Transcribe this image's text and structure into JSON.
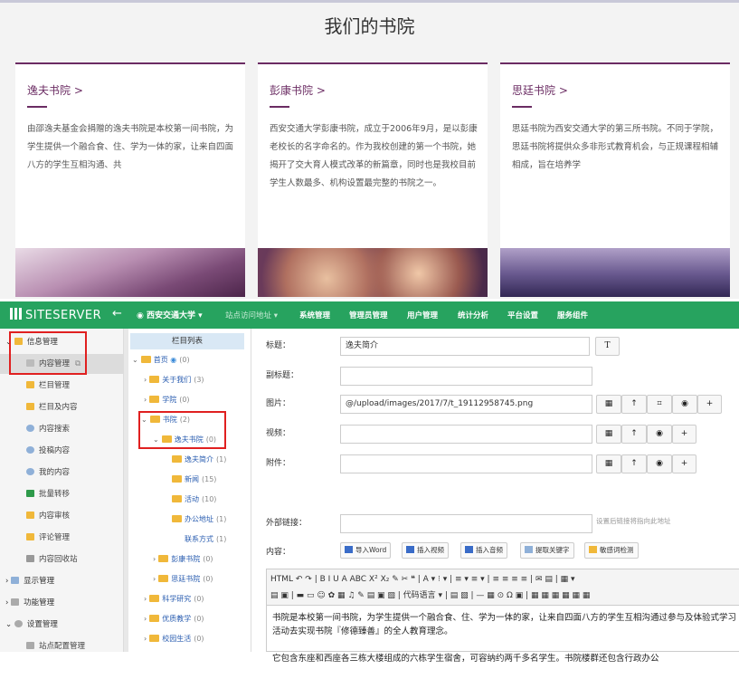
{
  "page": {
    "title": "我们的书院"
  },
  "cards": [
    {
      "title": "逸夫书院 >",
      "desc": "由邵逸夫基金会捐赠的逸夫书院是本校第一间书院，为学生提供一个融合食、住、学为一体的家，让来自四面八方的学生互相沟通、共"
    },
    {
      "title": "彭康书院 >",
      "desc": "西安交通大学彭康书院，成立于2006年9月，是以彭康老校长的名字命名的。作为我校创建的第一个书院，她揭开了交大育人模式改革的新篇章，同时也是我校目前学生人数最多、机构设置最完整的书院之一。"
    },
    {
      "title": "思廷书院 >",
      "desc": "思廷书院为西安交通大学的第三所书院。不同于学院，思廷书院将提供众多非形式教育机会，与正规课程相辅相成，旨在培养学"
    }
  ],
  "nav": {
    "logo": "SITESERVER",
    "back": "←",
    "site": "西安交通大学 ▾",
    "menu": [
      "站点访问地址 ▾",
      "系统管理",
      "管理员管理",
      "用户管理",
      "统计分析",
      "平台设置",
      "服务组件"
    ]
  },
  "sidebar": [
    {
      "label": "信息管理",
      "type": "group"
    },
    {
      "label": "内容管理",
      "type": "item",
      "selected": true
    },
    {
      "label": "栏目管理",
      "type": "item"
    },
    {
      "label": "栏目及内容",
      "type": "item"
    },
    {
      "label": "内容搜索",
      "type": "item"
    },
    {
      "label": "投稿内容",
      "type": "item"
    },
    {
      "label": "我的内容",
      "type": "item"
    },
    {
      "label": "批量转移",
      "type": "item"
    },
    {
      "label": "内容审核",
      "type": "item"
    },
    {
      "label": "评论管理",
      "type": "item"
    },
    {
      "label": "内容回收站",
      "type": "item"
    },
    {
      "label": "显示管理",
      "type": "group2"
    },
    {
      "label": "功能管理",
      "type": "group2"
    },
    {
      "label": "设置管理",
      "type": "group2"
    },
    {
      "label": "站点配置管理",
      "type": "item"
    }
  ],
  "tree": {
    "header": "栏目列表",
    "nodes": [
      {
        "label": "首页",
        "count": "(0)"
      },
      {
        "label": "关于我们",
        "count": "(3)"
      },
      {
        "label": "学院",
        "count": "(0)"
      },
      {
        "label": "书院",
        "count": "(2)"
      },
      {
        "label": "逸夫书院",
        "count": "(0)"
      },
      {
        "label": "逸夫简介",
        "count": "(1)"
      },
      {
        "label": "新闻",
        "count": "(15)"
      },
      {
        "label": "活动",
        "count": "(10)"
      },
      {
        "label": "办公地址",
        "count": "(1)"
      },
      {
        "label": "联系方式",
        "count": "(1)"
      },
      {
        "label": "彭康书院",
        "count": "(0)"
      },
      {
        "label": "思廷书院",
        "count": "(0)"
      },
      {
        "label": "科学研究",
        "count": "(0)"
      },
      {
        "label": "优质教学",
        "count": "(0)"
      },
      {
        "label": "校园生活",
        "count": "(0)"
      }
    ]
  },
  "form": {
    "title_label": "标题：",
    "title_value": "逸夫简介",
    "title_btn": "T",
    "subtitle_label": "副标题：",
    "image_label": "图片：",
    "image_value": "@/upload/images/2017/7/t_19112958745.png",
    "video_label": "视频：",
    "attach_label": "附件：",
    "link_label": "外部链接：",
    "link_note": "设置后链接将指向此地址",
    "content_label": "内容：",
    "tools": [
      "导入Word",
      "插入视频",
      "插入音频",
      "提取关键字",
      "敏感词检测"
    ],
    "editor_row1": "HTML ↶ ↷ | B I U A ABC X² X₂ ✎ ✂ ❝ | A ▾ ⁝ ▾ | ≡ ▾ ≡ ▾ | ≡ ≡ ≡ ≡ | ✉ ▤ | ▦ ▾",
    "editor_row2": "▤ ▣ | ▬ ▭ ☺ ✿ ▦ ♫ ✎ ▤ ▣ ▧ | 代码语言 ▾ | ▤ ▧ | — ▦ ⊙ Ω ▣ | ▦ ▦ ▦ ▦ ▦ ▦",
    "para1": "书院是本校第一间书院，为学生提供一个融合食、住、学为一体的家，让来自四面八方的学生互相沟通过参与及体验式学习活动去实现书院『修德臻善』的全人教育理念。",
    "para2": "它包含东座和西座各三栋大楼组成的六栋学生宿舍，可容纳约两千多名学生。书院楼群还包含行政办公"
  },
  "colors": {
    "accent": "#6b2c63",
    "green": "#27a35f",
    "red": "#e02020"
  }
}
